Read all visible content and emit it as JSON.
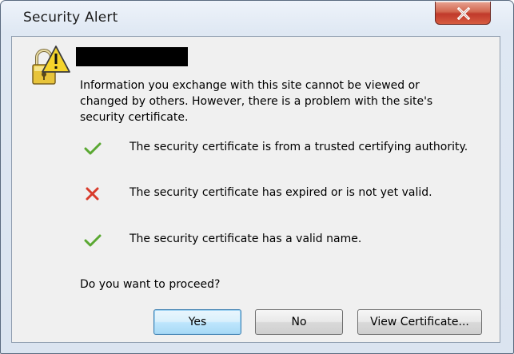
{
  "window": {
    "title": "Security Alert",
    "close_label": "close"
  },
  "alert": {
    "site_name": "",
    "info_text": "Information you exchange with this site cannot be viewed or changed by others. However, there is a problem with the site's security certificate.",
    "checks": [
      {
        "status": "valid",
        "icon": "check-icon",
        "text": "The security certificate is from a trusted certifying authority."
      },
      {
        "status": "invalid",
        "icon": "error-x-icon",
        "text": "The security certificate has expired or is not yet valid."
      },
      {
        "status": "valid",
        "icon": "check-icon",
        "text": "The security certificate has a valid name."
      }
    ],
    "question": "Do you want to proceed?"
  },
  "buttons": {
    "yes": "Yes",
    "no": "No",
    "view_certificate": "View Certificate..."
  },
  "colors": {
    "check": "#5aa832",
    "error": "#d83b2b",
    "close_button": "#c0392b"
  }
}
